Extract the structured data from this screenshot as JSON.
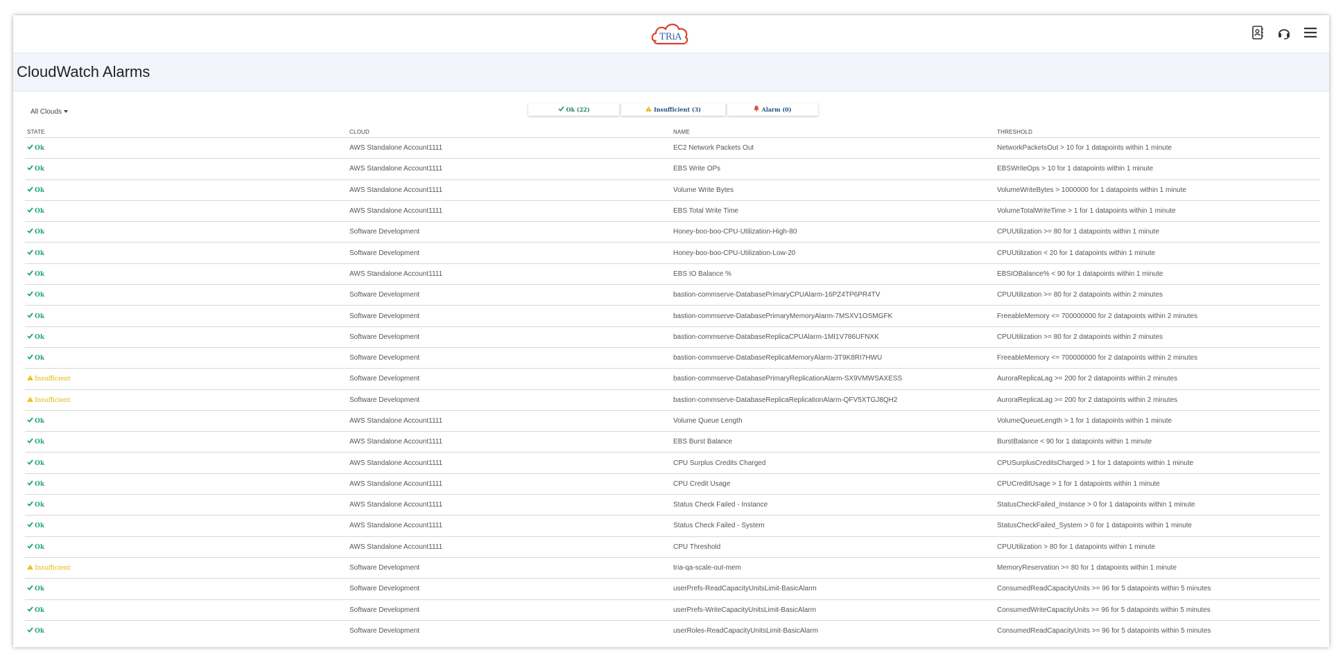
{
  "app": {
    "logo_text": "TRiA",
    "icons": [
      "contact-book-icon",
      "headset-icon",
      "hamburger-menu-icon"
    ]
  },
  "page": {
    "title": "CloudWatch Alarms"
  },
  "filters": {
    "cloud_select": "All Clouds",
    "ok_label": "Ok (22)",
    "insufficient_label": "Insufficient (3)",
    "alarm_label": "Alarm (0)"
  },
  "table": {
    "headers": [
      "STATE",
      "CLOUD",
      "NAME",
      "THRESHOLD"
    ],
    "rows": [
      {
        "state": "Ok",
        "cloud": "AWS Standalone Account1111",
        "name": "EC2 Network Packets Out",
        "threshold": "NetworkPacketsOut > 10 for 1 datapoints within 1 minute"
      },
      {
        "state": "Ok",
        "cloud": "AWS Standalone Account1111",
        "name": "EBS Write OPs",
        "threshold": "EBSWriteOps > 10 for 1 datapoints within 1 minute"
      },
      {
        "state": "Ok",
        "cloud": "AWS Standalone Account1111",
        "name": "Volume Write Bytes",
        "threshold": "VolumeWriteBytes > 1000000 for 1 datapoints within 1 minute"
      },
      {
        "state": "Ok",
        "cloud": "AWS Standalone Account1111",
        "name": "EBS Total Write Time",
        "threshold": "VolumeTotalWriteTime > 1 for 1 datapoints within 1 minute"
      },
      {
        "state": "Ok",
        "cloud": "Software Development",
        "name": "Honey-boo-boo-CPU-Utilization-High-80",
        "threshold": "CPUUtilization >= 80 for 1 datapoints within 1 minute"
      },
      {
        "state": "Ok",
        "cloud": "Software Development",
        "name": "Honey-boo-boo-CPU-Utilization-Low-20",
        "threshold": "CPUUtilization < 20 for 1 datapoints within 1 minute"
      },
      {
        "state": "Ok",
        "cloud": "AWS Standalone Account1111",
        "name": "EBS IO Balance %",
        "threshold": "EBSIOBalance% < 90 for 1 datapoints within 1 minute"
      },
      {
        "state": "Ok",
        "cloud": "Software Development",
        "name": "bastion-commserve-DatabasePrimaryCPUAlarm-16PZ4TP6PR4TV",
        "threshold": "CPUUtilization >= 80 for 2 datapoints within 2 minutes"
      },
      {
        "state": "Ok",
        "cloud": "Software Development",
        "name": "bastion-commserve-DatabasePrimaryMemoryAlarm-7MSXV1OSMGFK",
        "threshold": "FreeableMemory <= 700000000 for 2 datapoints within 2 minutes"
      },
      {
        "state": "Ok",
        "cloud": "Software Development",
        "name": "bastion-commserve-DatabaseReplicaCPUAlarm-1MI1V786UFNXK",
        "threshold": "CPUUtilization >= 80 for 2 datapoints within 2 minutes"
      },
      {
        "state": "Ok",
        "cloud": "Software Development",
        "name": "bastion-commserve-DatabaseReplicaMemoryAlarm-3T9K8RI7HWU",
        "threshold": "FreeableMemory <= 700000000 for 2 datapoints within 2 minutes"
      },
      {
        "state": "Insufficient",
        "cloud": "Software Development",
        "name": "bastion-commserve-DatabasePrimaryReplicationAlarm-SX9VMWSAXESS",
        "threshold": "AuroraReplicaLag >= 200 for 2 datapoints within 2 minutes"
      },
      {
        "state": "Insufficient",
        "cloud": "Software Development",
        "name": "bastion-commserve-DatabaseReplicaReplicationAlarm-QFV5XTGJ8QH2",
        "threshold": "AuroraReplicaLag >= 200 for 2 datapoints within 2 minutes"
      },
      {
        "state": "Ok",
        "cloud": "AWS Standalone Account1111",
        "name": "Volume Queue Length",
        "threshold": "VolumeQueueLength > 1 for 1 datapoints within 1 minute"
      },
      {
        "state": "Ok",
        "cloud": "AWS Standalone Account1111",
        "name": "EBS Burst Balance",
        "threshold": "BurstBalance < 90 for 1 datapoints within 1 minute"
      },
      {
        "state": "Ok",
        "cloud": "AWS Standalone Account1111",
        "name": "CPU Surplus Credits Charged",
        "threshold": "CPUSurplusCreditsCharged > 1 for 1 datapoints within 1 minute"
      },
      {
        "state": "Ok",
        "cloud": "AWS Standalone Account1111",
        "name": "CPU Credit Usage",
        "threshold": "CPUCreditUsage > 1 for 1 datapoints within 1 minute"
      },
      {
        "state": "Ok",
        "cloud": "AWS Standalone Account1111",
        "name": "Status Check Failed - Instance",
        "threshold": "StatusCheckFailed_Instance > 0 for 1 datapoints within 1 minute"
      },
      {
        "state": "Ok",
        "cloud": "AWS Standalone Account1111",
        "name": "Status Check Failed - System",
        "threshold": "StatusCheckFailed_System > 0 for 1 datapoints within 1 minute"
      },
      {
        "state": "Ok",
        "cloud": "AWS Standalone Account1111",
        "name": "CPU Threshold",
        "threshold": "CPUUtilization > 80 for 1 datapoints within 1 minute"
      },
      {
        "state": "Insufficient",
        "cloud": "Software Development",
        "name": "tria-qa-scale-out-mem",
        "threshold": "MemoryReservation >= 80 for 1 datapoints within 1 minute"
      },
      {
        "state": "Ok",
        "cloud": "Software Development",
        "name": "userPrefs-ReadCapacityUnitsLimit-BasicAlarm",
        "threshold": "ConsumedReadCapacityUnits >= 96 for 5 datapoints within 5 minutes"
      },
      {
        "state": "Ok",
        "cloud": "Software Development",
        "name": "userPrefs-WriteCapacityUnitsLimit-BasicAlarm",
        "threshold": "ConsumedWriteCapacityUnits >= 96 for 5 datapoints within 5 minutes"
      },
      {
        "state": "Ok",
        "cloud": "Software Development",
        "name": "userRoles-ReadCapacityUnitsLimit-BasicAlarm",
        "threshold": "ConsumedReadCapacityUnits >= 96 for 5 datapoints within 5 minutes"
      }
    ]
  },
  "colors": {
    "ok": "#1fa477",
    "insufficient": "#e6b400",
    "alarm": "#e04a2f",
    "logo_red": "#d9412b",
    "logo_blue": "#2a5ea8"
  }
}
